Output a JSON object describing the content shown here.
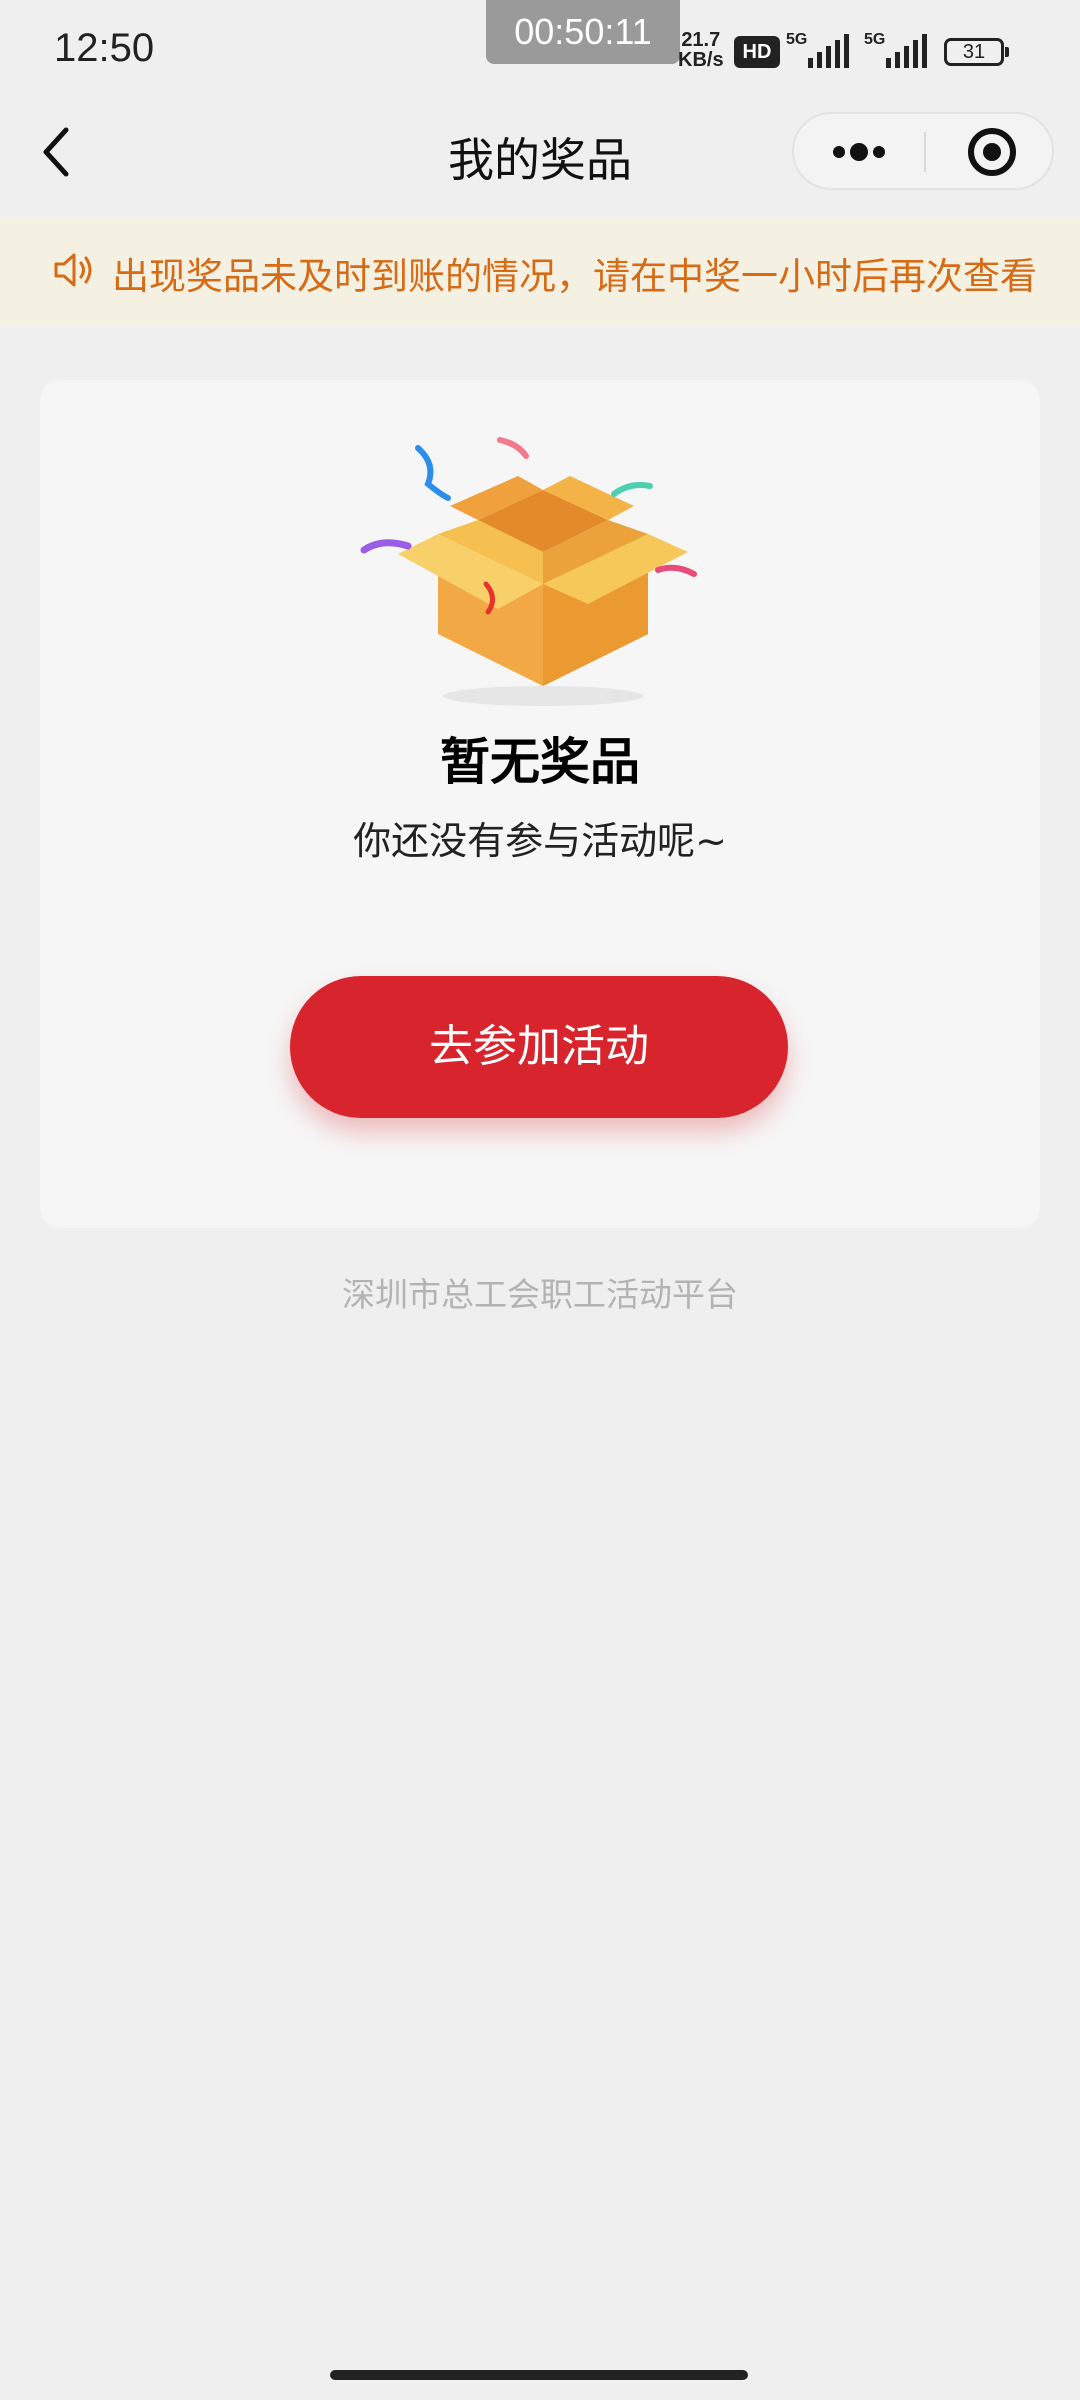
{
  "status_bar": {
    "time": "12:50",
    "recording_timer": "00:50:11",
    "net_speed_value": "21.7",
    "net_speed_unit": "KB/s",
    "hd_badge": "HD",
    "signal_1_label": "5G",
    "signal_2_label": "5G",
    "battery": "31"
  },
  "nav": {
    "title": "我的奖品",
    "back_icon": "chevron-left-icon",
    "more_icon": "more-dots-icon",
    "close_icon": "target-close-icon"
  },
  "notice": {
    "icon": "speaker-icon",
    "text": "出现奖品未及时到账的情况，请在中奖一小时后再次查看"
  },
  "empty_state": {
    "illustration": "open-gift-box-icon",
    "title": "暂无奖品",
    "subtitle": "你还没有参与活动呢~",
    "button_label": "去参加活动"
  },
  "footer": {
    "text": "深圳市总工会职工活动平台"
  },
  "colors": {
    "accent_red": "#d8242c",
    "notice_text": "#d76a14",
    "notice_bg": "#f4f1e3",
    "page_bg": "#efefef"
  }
}
